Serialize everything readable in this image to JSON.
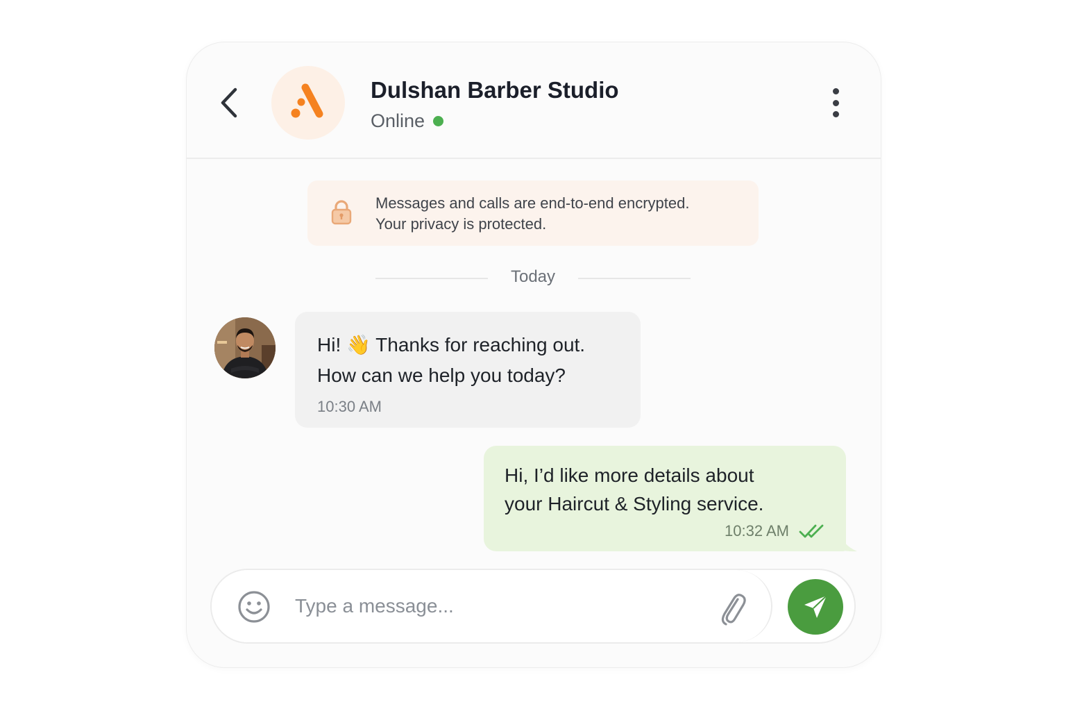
{
  "header": {
    "title": "Dulshan Barber Studio",
    "status": "Online",
    "back_icon": "chevron-left-icon",
    "menu_icon": "more-vertical-icon",
    "logo_color": "#f58220",
    "online_color": "#4caf50"
  },
  "encryption_notice": {
    "line1": "Messages and calls are end-to-end encrypted.",
    "line2": "Your privacy is protected.",
    "icon": "lock-icon"
  },
  "day_separator": "Today",
  "messages": [
    {
      "direction": "incoming",
      "line1": "Hi! 👋 Thanks for reaching out.",
      "line2": "How can we help you today?",
      "time": "10:30 AM"
    },
    {
      "direction": "outgoing",
      "line1": "Hi, I’d like more details about",
      "line2": "your Haircut & Styling service.",
      "time": "10:32 AM",
      "status_icon": "double-check-icon"
    }
  ],
  "composer": {
    "placeholder": "Type a message...",
    "emoji_icon": "smiley-icon",
    "attach_icon": "paperclip-icon",
    "send_icon": "send-icon",
    "send_color": "#4a9c3f"
  }
}
